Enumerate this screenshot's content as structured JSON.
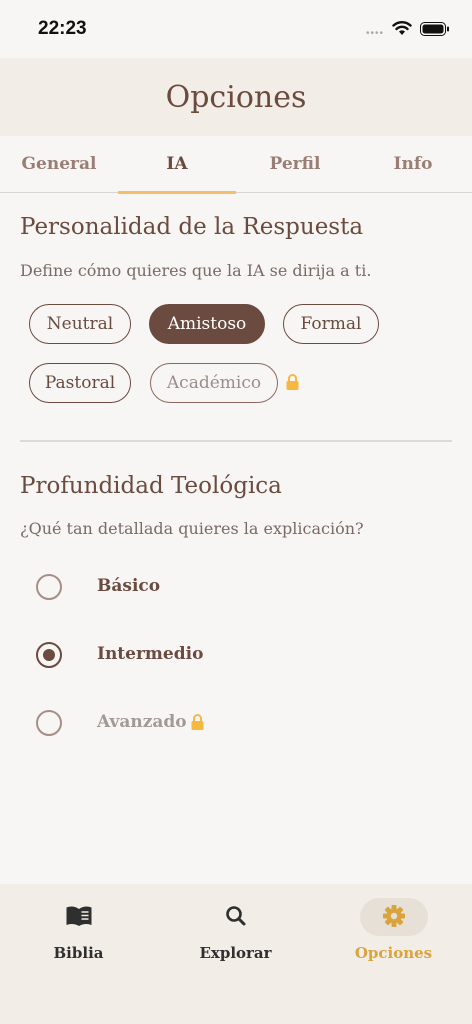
{
  "status_bar": {
    "time": "22:23",
    "signal_dots": "••••"
  },
  "header": {
    "title": "Opciones"
  },
  "tabs": [
    {
      "label": "General",
      "active": false
    },
    {
      "label": "IA",
      "active": true
    },
    {
      "label": "Perfil",
      "active": false
    },
    {
      "label": "Info",
      "active": false
    }
  ],
  "personality": {
    "title": "Personalidad de la Respuesta",
    "description": "Define cómo quieres que la IA se dirija a ti.",
    "options": [
      {
        "label": "Neutral",
        "selected": false,
        "locked": false
      },
      {
        "label": "Amistoso",
        "selected": true,
        "locked": false
      },
      {
        "label": "Formal",
        "selected": false,
        "locked": false
      },
      {
        "label": "Pastoral",
        "selected": false,
        "locked": false
      },
      {
        "label": "Académico",
        "selected": false,
        "locked": true
      }
    ]
  },
  "depth": {
    "title": "Profundidad Teológica",
    "description": "¿Qué tan detallada quieres la explicación?",
    "options": [
      {
        "label": "Básico",
        "checked": false,
        "locked": false
      },
      {
        "label": "Intermedio",
        "checked": true,
        "locked": false
      },
      {
        "label": "Avanzado",
        "checked": false,
        "locked": true
      }
    ]
  },
  "bottom_nav": [
    {
      "label": "Biblia",
      "icon": "book-icon",
      "active": false
    },
    {
      "label": "Explorar",
      "icon": "search-icon",
      "active": false
    },
    {
      "label": "Opciones",
      "icon": "gear-icon",
      "active": true
    }
  ],
  "colors": {
    "accent_brown": "#6b4a3f",
    "tab_underline": "#f2c06b",
    "active_nav": "#d9a43d",
    "lock": "#f5b942",
    "header_bg": "#f2eee7"
  }
}
